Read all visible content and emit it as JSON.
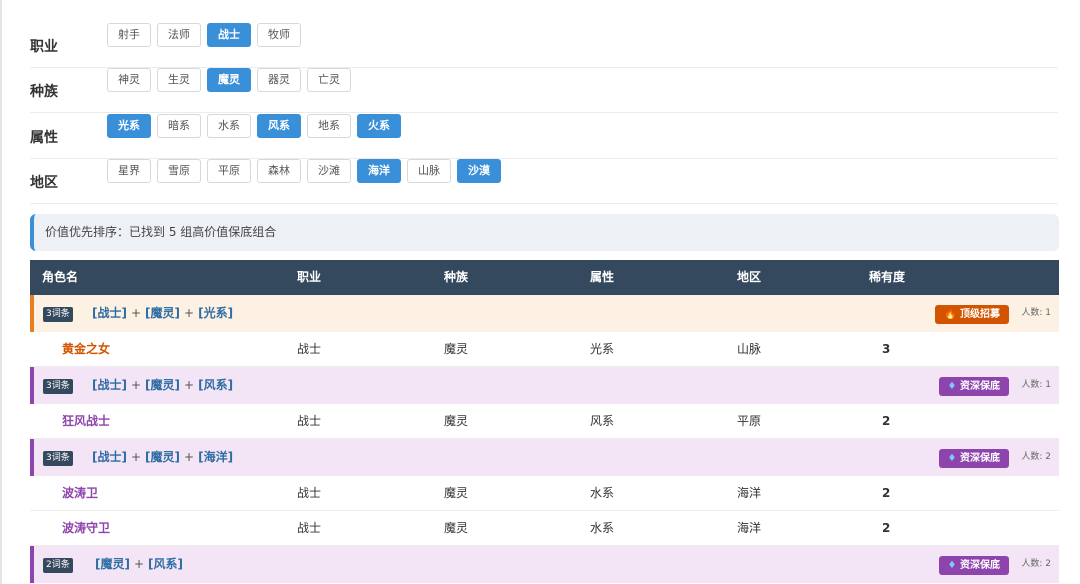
{
  "filters": [
    {
      "label": "职业",
      "options": [
        "射手",
        "法师",
        "战士",
        "牧师"
      ],
      "active": [
        2
      ]
    },
    {
      "label": "种族",
      "options": [
        "神灵",
        "生灵",
        "魔灵",
        "器灵",
        "亡灵"
      ],
      "active": [
        2
      ]
    },
    {
      "label": "属性",
      "options": [
        "光系",
        "暗系",
        "水系",
        "风系",
        "地系",
        "火系"
      ],
      "active": [
        0,
        3,
        5
      ]
    },
    {
      "label": "地区",
      "options": [
        "星界",
        "雪原",
        "平原",
        "森林",
        "沙滩",
        "海洋",
        "山脉",
        "沙漠"
      ],
      "active": [
        5,
        7
      ]
    }
  ],
  "notice": "价值优先排序：已找到 5 组高价值保底组合",
  "table": {
    "headers": [
      "角色名",
      "职业",
      "种族",
      "属性",
      "地区",
      "稀有度"
    ],
    "groups": [
      {
        "tag": "3词条",
        "terms": [
          "[战士]",
          "[魔灵]",
          "[光系]"
        ],
        "badge": "顶级招募",
        "badge_icon": "flame-icon",
        "count": "人数: 1",
        "theme": "orange",
        "rows": [
          {
            "name": "黄金之女",
            "job": "战士",
            "race": "魔灵",
            "attr": "光系",
            "region": "山脉",
            "rarity": "3"
          }
        ]
      },
      {
        "tag": "3词条",
        "terms": [
          "[战士]",
          "[魔灵]",
          "[风系]"
        ],
        "badge": "资深保底",
        "badge_icon": "diamond-icon",
        "count": "人数: 1",
        "theme": "purple",
        "rows": [
          {
            "name": "狂风战士",
            "job": "战士",
            "race": "魔灵",
            "attr": "风系",
            "region": "平原",
            "rarity": "2"
          }
        ]
      },
      {
        "tag": "3词条",
        "terms": [
          "[战士]",
          "[魔灵]",
          "[海洋]"
        ],
        "badge": "资深保底",
        "badge_icon": "diamond-icon",
        "count": "人数: 2",
        "theme": "purple",
        "rows": [
          {
            "name": "波涛卫",
            "job": "战士",
            "race": "魔灵",
            "attr": "水系",
            "region": "海洋",
            "rarity": "2"
          },
          {
            "name": "波涛守卫",
            "job": "战士",
            "race": "魔灵",
            "attr": "水系",
            "region": "海洋",
            "rarity": "2"
          }
        ]
      },
      {
        "tag": "2词条",
        "terms": [
          "[魔灵]",
          "[风系]"
        ],
        "badge": "资深保底",
        "badge_icon": "diamond-icon",
        "count": "人数: 2",
        "theme": "purple",
        "rows": []
      }
    ]
  },
  "colors": {
    "accent": "#3a8fd9",
    "header_bg": "#34495e",
    "purple": "#8e44ad",
    "orange": "#d35400"
  }
}
